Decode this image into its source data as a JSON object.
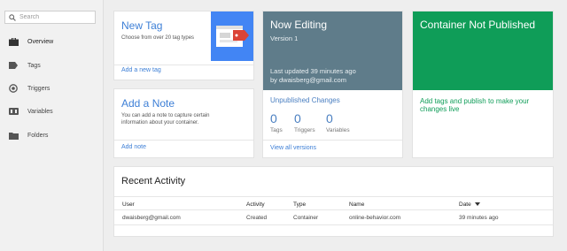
{
  "sidebar": {
    "search_placeholder": "Search",
    "items": [
      {
        "label": "Overview",
        "icon": "briefcase-icon"
      },
      {
        "label": "Tags",
        "icon": "tag-icon"
      },
      {
        "label": "Triggers",
        "icon": "trigger-icon"
      },
      {
        "label": "Variables",
        "icon": "variables-icon"
      },
      {
        "label": "Folders",
        "icon": "folder-icon"
      }
    ]
  },
  "new_tag": {
    "title": "New Tag",
    "description": "Choose from over 20 tag types",
    "link": "Add a new tag",
    "accent": "#4285f4"
  },
  "add_note": {
    "title": "Add a Note",
    "description": "You can add a note to capture certain information about your container.",
    "link": "Add note"
  },
  "now_editing": {
    "title": "Now Editing",
    "version": "Version 1",
    "updated": "Last updated 39 minutes ago",
    "by": "by dwaisberg@gmail.com",
    "color": "#5f7c8a"
  },
  "unpublished": {
    "title": "Unpublished Changes",
    "stats": [
      {
        "value": "0",
        "label": "Tags"
      },
      {
        "value": "0",
        "label": "Triggers"
      },
      {
        "value": "0",
        "label": "Variables"
      }
    ],
    "link": "View all versions"
  },
  "not_published": {
    "title": "Container Not Published",
    "message": "Add tags and publish to make your changes live",
    "color": "#0f9d58"
  },
  "recent_activity": {
    "title": "Recent Activity",
    "columns": [
      "User",
      "Activity",
      "Type",
      "Name",
      "Date"
    ],
    "rows": [
      [
        "dwaisberg@gmail.com",
        "Created",
        "Container",
        "online-behavior.com",
        "39 minutes ago"
      ]
    ]
  }
}
